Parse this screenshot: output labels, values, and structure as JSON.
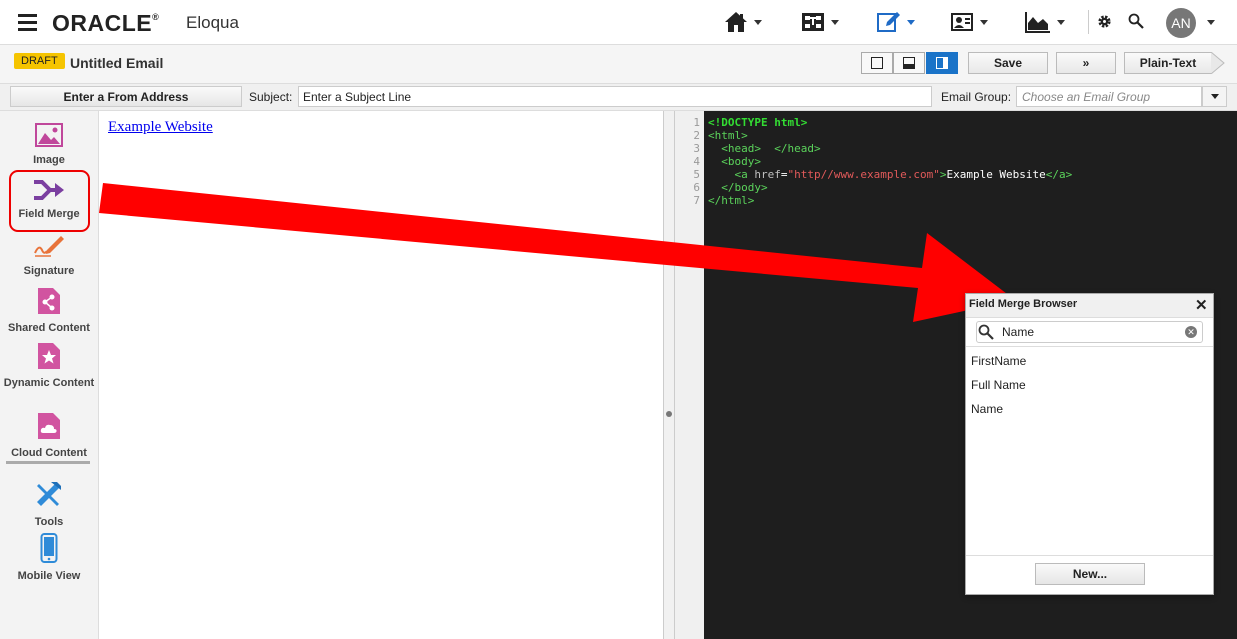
{
  "topnav": {
    "logo": "ORACLE",
    "logo_mark": "®",
    "product": "Eloqua",
    "user_initials": "AN",
    "icons": [
      "home-icon",
      "campaigns-icon",
      "edit-icon",
      "contacts-icon",
      "analytics-icon",
      "settings-icon",
      "search-icon"
    ],
    "accent_color": "#1f6bc6"
  },
  "header": {
    "status_badge": "DRAFT",
    "title": "Untitled Email",
    "save_label": "Save",
    "more_label": "»",
    "plaintext_label": "Plain-Text"
  },
  "fields": {
    "from_address_label": "Enter a From Address",
    "subject_label": "Subject:",
    "subject_value": "Enter a Subject Line",
    "email_group_label": "Email Group:",
    "email_group_placeholder": "Choose an Email Group"
  },
  "sidebar": {
    "items": [
      {
        "label": "Image",
        "icon": "image-icon"
      },
      {
        "label": "Field Merge",
        "icon": "field-merge-icon"
      },
      {
        "label": "Signature",
        "icon": "signature-icon"
      },
      {
        "label": "Shared Content",
        "icon": "shared-content-icon"
      },
      {
        "label": "Dynamic Content",
        "icon": "dynamic-content-icon"
      },
      {
        "label": "Cloud Content",
        "icon": "cloud-content-icon"
      },
      {
        "label": "Tools",
        "icon": "tools-icon"
      },
      {
        "label": "Mobile View",
        "icon": "mobile-view-icon"
      }
    ]
  },
  "canvas": {
    "link_text": "Example Website"
  },
  "code": {
    "line_numbers": [
      "1",
      "2",
      "3",
      "4",
      "5",
      "6",
      "7"
    ],
    "doctype": "<!DOCTYPE html>",
    "html_open": "<html>",
    "head": "  <head>  </head>",
    "body_open": "  <body>",
    "a_indent": "    ",
    "a_open": "<a ",
    "a_attr": "href",
    "a_eq": "=",
    "a_value": "\"http//www.example.com\"",
    "a_close_bracket": ">",
    "a_text": "Example Website",
    "a_end": "</a>",
    "body_close": "  </body>",
    "html_close": "</html>"
  },
  "field_merge_browser": {
    "title": "Field Merge Browser",
    "close": "✕",
    "search_value": "Name",
    "items": [
      "FirstName",
      "Full Name",
      "Name"
    ],
    "new_button": "New..."
  }
}
